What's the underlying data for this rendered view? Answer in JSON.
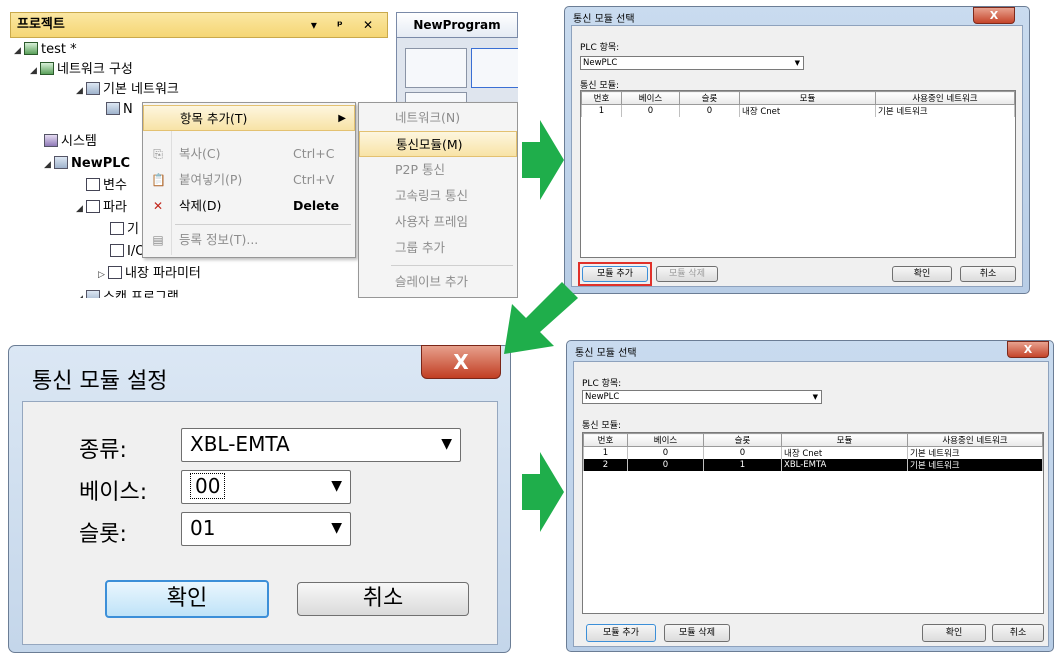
{
  "panel1": {
    "header_title": "프로젝트",
    "header_controls": "▾ ᵖ ✕",
    "tab_title": "NewProgram",
    "tree": [
      {
        "label": "test *"
      },
      {
        "label": "네트워크 구성"
      },
      {
        "label": "기본 네트워크"
      },
      {
        "label": "N"
      },
      {
        "label": "시스템"
      },
      {
        "label": "NewPLC"
      },
      {
        "label": "변수"
      },
      {
        "label": "파라"
      },
      {
        "label": "기"
      },
      {
        "label": "I/O 파라미터"
      },
      {
        "label": "내장 파라미터"
      },
      {
        "label": "스캔 프로그램"
      }
    ],
    "context_menu": [
      {
        "label": "항목 추가(T)",
        "shortcut": ""
      },
      {
        "label": "복사(C)",
        "shortcut": "Ctrl+C"
      },
      {
        "label": "붙여넣기(P)",
        "shortcut": "Ctrl+V"
      },
      {
        "label": "삭제(D)",
        "shortcut": "Delete"
      },
      {
        "label": "등록 정보(T)...",
        "shortcut": ""
      }
    ],
    "submenu": [
      {
        "label": "네트워크(N)"
      },
      {
        "label": "통신모듈(M)"
      },
      {
        "label": "P2P 통신"
      },
      {
        "label": "고속링크 통신"
      },
      {
        "label": "사용자 프레임"
      },
      {
        "label": "그룹 추가"
      },
      {
        "label": "슬레이브 추가"
      }
    ]
  },
  "dialog_select_before": {
    "title": "통신 모듈 선택",
    "plc_label": "PLC 항목:",
    "plc_value": "NewPLC",
    "module_label": "통신 모듈:",
    "columns": [
      "번호",
      "베이스",
      "슬롯",
      "모듈",
      "사용중인 네트워크"
    ],
    "rows": [
      [
        "1",
        "0",
        "0",
        "내장 Cnet",
        "기본 네트워크"
      ]
    ],
    "add_button": "모듈 추가",
    "delete_button": "모듈 삭제",
    "ok_button": "확인",
    "cancel_button": "취소"
  },
  "dialog_settings": {
    "title": "통신 모듈 설정",
    "close_glyph": "X",
    "type_label": "종류:",
    "type_value": "XBL-EMTA",
    "base_label": "베이스:",
    "base_value": "00",
    "slot_label": "슬롯:",
    "slot_value": "01",
    "ok_button": "확인",
    "cancel_button": "취소"
  },
  "dialog_select_after": {
    "title": "통신 모듈 선택",
    "plc_label": "PLC 항목:",
    "plc_value": "NewPLC",
    "module_label": "통신 모듈:",
    "columns": [
      "번호",
      "베이스",
      "슬롯",
      "모듈",
      "사용중인 네트워크"
    ],
    "rows": [
      [
        "1",
        "0",
        "0",
        "내장 Cnet",
        "기본 네트워크"
      ],
      [
        "2",
        "0",
        "1",
        "XBL-EMTA",
        "기본 네트워크"
      ]
    ],
    "add_button": "모듈 추가",
    "delete_button": "모듈 삭제",
    "ok_button": "확인",
    "cancel_button": "취소"
  },
  "colors": {
    "arrow": "#1fae4b",
    "highlight_box": "#e0312a",
    "button_focus": "#3c8fd8"
  }
}
